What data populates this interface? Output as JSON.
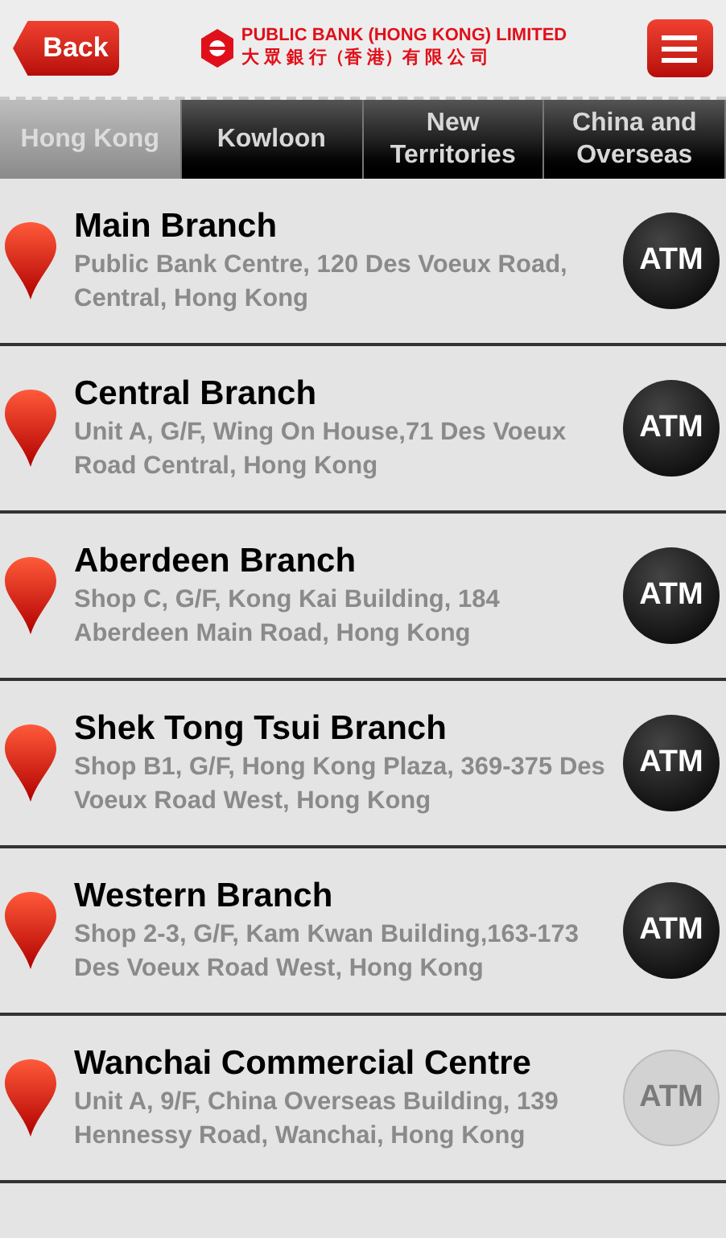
{
  "header": {
    "back": "Back",
    "logo_en": "PUBLIC BANK (HONG KONG) LIMITED",
    "logo_zh": "大 眾 銀 行（香 港）有 限 公 司"
  },
  "tabs": [
    {
      "label": "Hong Kong",
      "selected": true
    },
    {
      "label": "Kowloon",
      "selected": false
    },
    {
      "label": "New Territories",
      "selected": false
    },
    {
      "label": "China and Overseas",
      "selected": false
    }
  ],
  "branches": [
    {
      "name": "Main Branch",
      "address": "Public Bank Centre, 120 Des Voeux Road, Central, Hong Kong",
      "atm": "ATM",
      "atm_available": true
    },
    {
      "name": "Central Branch",
      "address": "Unit A, G/F, Wing On House,71 Des Voeux Road Central, Hong Kong",
      "atm": "ATM",
      "atm_available": true
    },
    {
      "name": "Aberdeen Branch",
      "address": "Shop C, G/F, Kong Kai Building, 184 Aberdeen Main Road, Hong Kong",
      "atm": "ATM",
      "atm_available": true
    },
    {
      "name": "Shek Tong Tsui Branch",
      "address": "Shop B1, G/F, Hong Kong Plaza, 369-375 Des Voeux Road West, Hong Kong",
      "atm": "ATM",
      "atm_available": true
    },
    {
      "name": "Western Branch",
      "address": "Shop 2-3, G/F, Kam Kwan Building,163-173 Des Voeux Road West, Hong Kong",
      "atm": "ATM",
      "atm_available": true
    },
    {
      "name": "Wanchai Commercial Centre",
      "address": "Unit A, 9/F, China Overseas Building, 139 Hennessy Road, Wanchai, Hong Kong",
      "atm": "ATM",
      "atm_available": false
    }
  ]
}
